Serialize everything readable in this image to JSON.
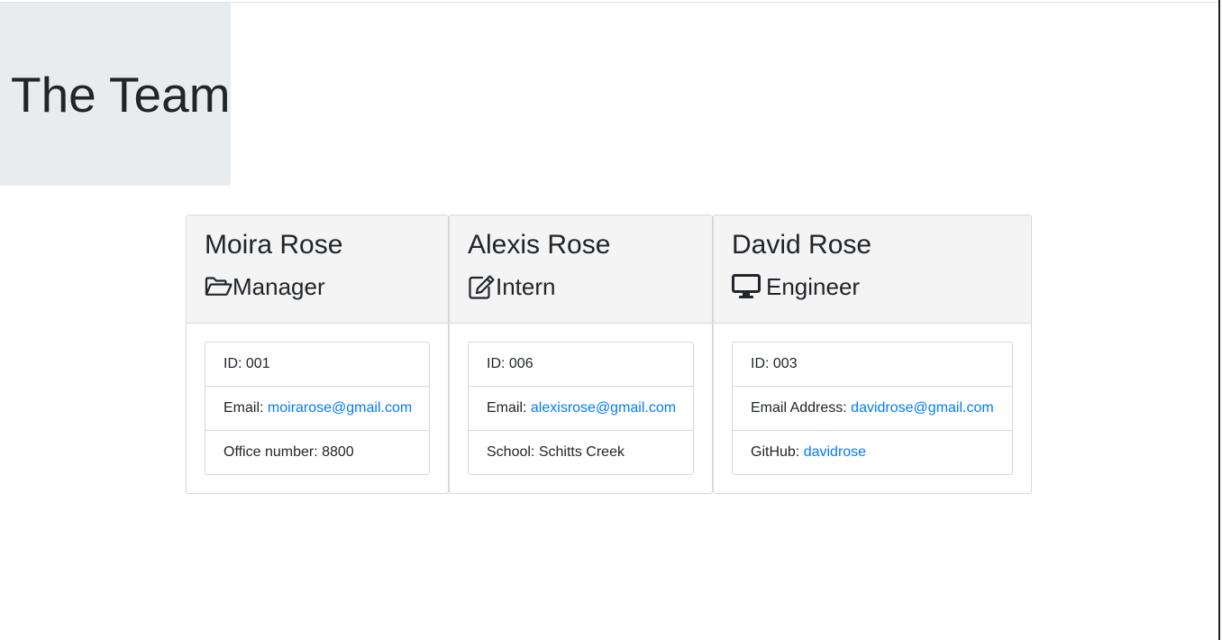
{
  "header": {
    "title": "The Team"
  },
  "team": [
    {
      "name": "Moira Rose",
      "role": "Manager",
      "role_icon": "folder-open-icon",
      "id_text": "ID: 001",
      "email_label": "Email:",
      "email": "moirarose@gmail.com",
      "extra_label": "Office number:",
      "extra_value": "8800"
    },
    {
      "name": "Alexis Rose",
      "role": "Intern",
      "role_icon": "edit-icon",
      "id_text": "ID: 006",
      "email_label": "Email:",
      "email": "alexisrose@gmail.com",
      "extra_label": "School:",
      "extra_value": "Schitts Creek"
    },
    {
      "name": "David Rose",
      "role": "Engineer",
      "role_icon": "desktop-icon",
      "id_text": "ID: 003",
      "email_label": "Email Address:",
      "email": "davidrose@gmail.com",
      "extra_label": "GitHub:",
      "extra_value": "davidrose"
    }
  ],
  "colors": {
    "link": "#007bff",
    "jumbotron_bg": "#e9ecef",
    "card_header_bg": "#f4f4f4"
  }
}
